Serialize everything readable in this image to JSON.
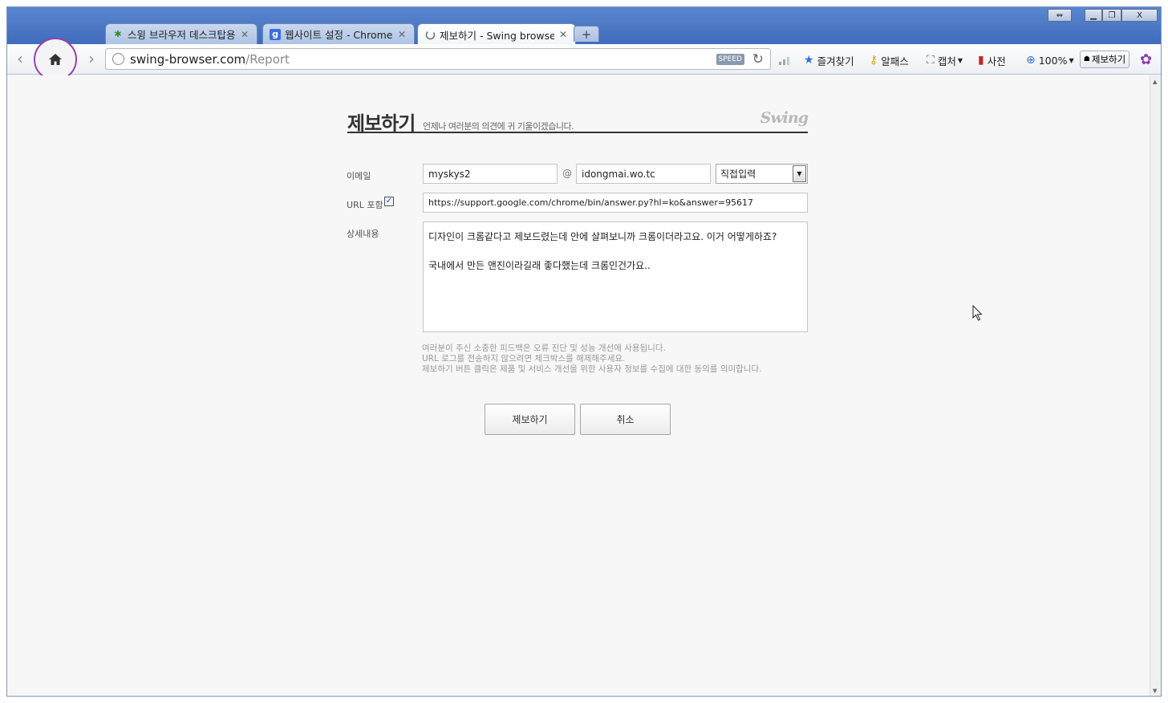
{
  "browser": {
    "tabs": [
      {
        "title": "스윙 브라우저 데스크탑용",
        "icon": "swing-leaf-icon",
        "active": false
      },
      {
        "title": "웹사이트 설정 - Chrome 도",
        "icon": "google-icon",
        "active": false
      },
      {
        "title": "제보하기 - Swing browser",
        "icon": "loading-icon",
        "active": true
      }
    ],
    "new_tab_label": "+",
    "address": {
      "host": "swing-browser.com",
      "path": "/Report",
      "speed_label": "SPEED"
    },
    "toolbar": {
      "favorites": "즐겨찾기",
      "alpass": "알패스",
      "capture": "캡처",
      "dictionary": "사전",
      "zoom": "100%",
      "report": "제보하기"
    }
  },
  "page": {
    "title": "제보하기",
    "subtitle": "언제나 여러분의 의견에 귀 기울이겠습니다.",
    "logo": "Swing",
    "email_label": "이메일",
    "email_user": "myskys2",
    "email_at": "@",
    "email_domain": "idongmai.wo.tc",
    "domain_select": "직접입력",
    "url_label": "URL 포함",
    "url_checked": true,
    "url_value": "https://support.google.com/chrome/bin/answer.py?hl=ko&answer=95617",
    "detail_label": "상세내용",
    "detail_lines": [
      "디자인이 크롬같다고 제보드렸는데 안에 살펴보니까 크롬이더라고요. 이거 어떻게하죠?",
      "국내에서 만든 앤진이라길래 좋다했는데 크롬인건가요.."
    ],
    "notice_lines": [
      "여러분이 주신 소중한 피드백은 오류 진단 및 성능 개선에 사용됩니다.",
      "URL 로그를 전송하지 않으려면 체크박스를 해제해주세요.",
      "제보하기 버튼 클릭은 제품 및 서비스 개선을 위한 사용자 정보를 수집에 대한 동의를 의미합니다."
    ],
    "submit_label": "제보하기",
    "cancel_label": "취소"
  },
  "colors": {
    "accent": "#8c39b4",
    "tabstrip": "#4a77c6"
  }
}
